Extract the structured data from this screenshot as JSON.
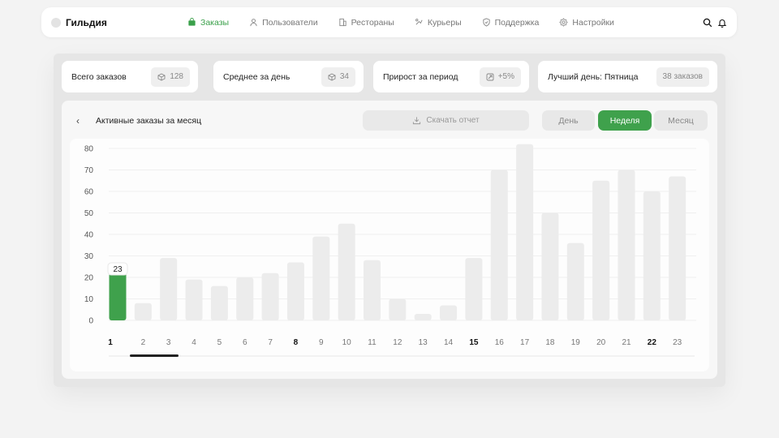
{
  "app": {
    "name": "Гильдия"
  },
  "nav": [
    {
      "label": "Заказы",
      "icon": "bag-icon",
      "active": true
    },
    {
      "label": "Пользователи",
      "icon": "user-icon",
      "active": false
    },
    {
      "label": "Рестораны",
      "icon": "building-icon",
      "active": false
    },
    {
      "label": "Курьеры",
      "icon": "courier-icon",
      "active": false
    },
    {
      "label": "Поддержка",
      "icon": "shield-icon",
      "active": false
    },
    {
      "label": "Настройки",
      "icon": "gear-icon",
      "active": false
    }
  ],
  "stats": [
    {
      "label": "Всего заказов",
      "value": "128",
      "icon": "box-icon"
    },
    {
      "label": "Среднее за день",
      "value": "34",
      "icon": "box-icon"
    },
    {
      "label": "Прирост за период",
      "value": "+5%",
      "icon": "growth-icon"
    },
    {
      "label": "Лучший день: Пятница",
      "value": "38 заказов",
      "icon": ""
    }
  ],
  "card": {
    "title": "Активные заказы за месяц",
    "download_label": "Скачать отчет",
    "periods": [
      "День",
      "Неделя",
      "Месяц"
    ],
    "active_period": "Неделя"
  },
  "colors": {
    "accent": "#3fa14c",
    "bar": "#ececec"
  },
  "chart_data": {
    "type": "bar",
    "categories": [
      "1",
      "2",
      "3",
      "4",
      "5",
      "6",
      "7",
      "8",
      "9",
      "10",
      "11",
      "12",
      "13",
      "14",
      "15",
      "16",
      "17",
      "18",
      "19",
      "20",
      "21",
      "22",
      "23"
    ],
    "values": [
      23,
      8,
      29,
      19,
      16,
      20,
      22,
      27,
      39,
      45,
      28,
      10,
      3,
      7,
      29,
      70,
      82,
      50,
      36,
      65,
      70,
      60,
      67
    ],
    "highlighted_index": 0,
    "data_label": "23",
    "bold_categories": [
      "1",
      "8",
      "15",
      "22"
    ],
    "y_ticks": [
      0,
      10,
      20,
      30,
      40,
      50,
      60,
      70,
      80
    ],
    "ylim": [
      0,
      80
    ],
    "grid": true
  }
}
